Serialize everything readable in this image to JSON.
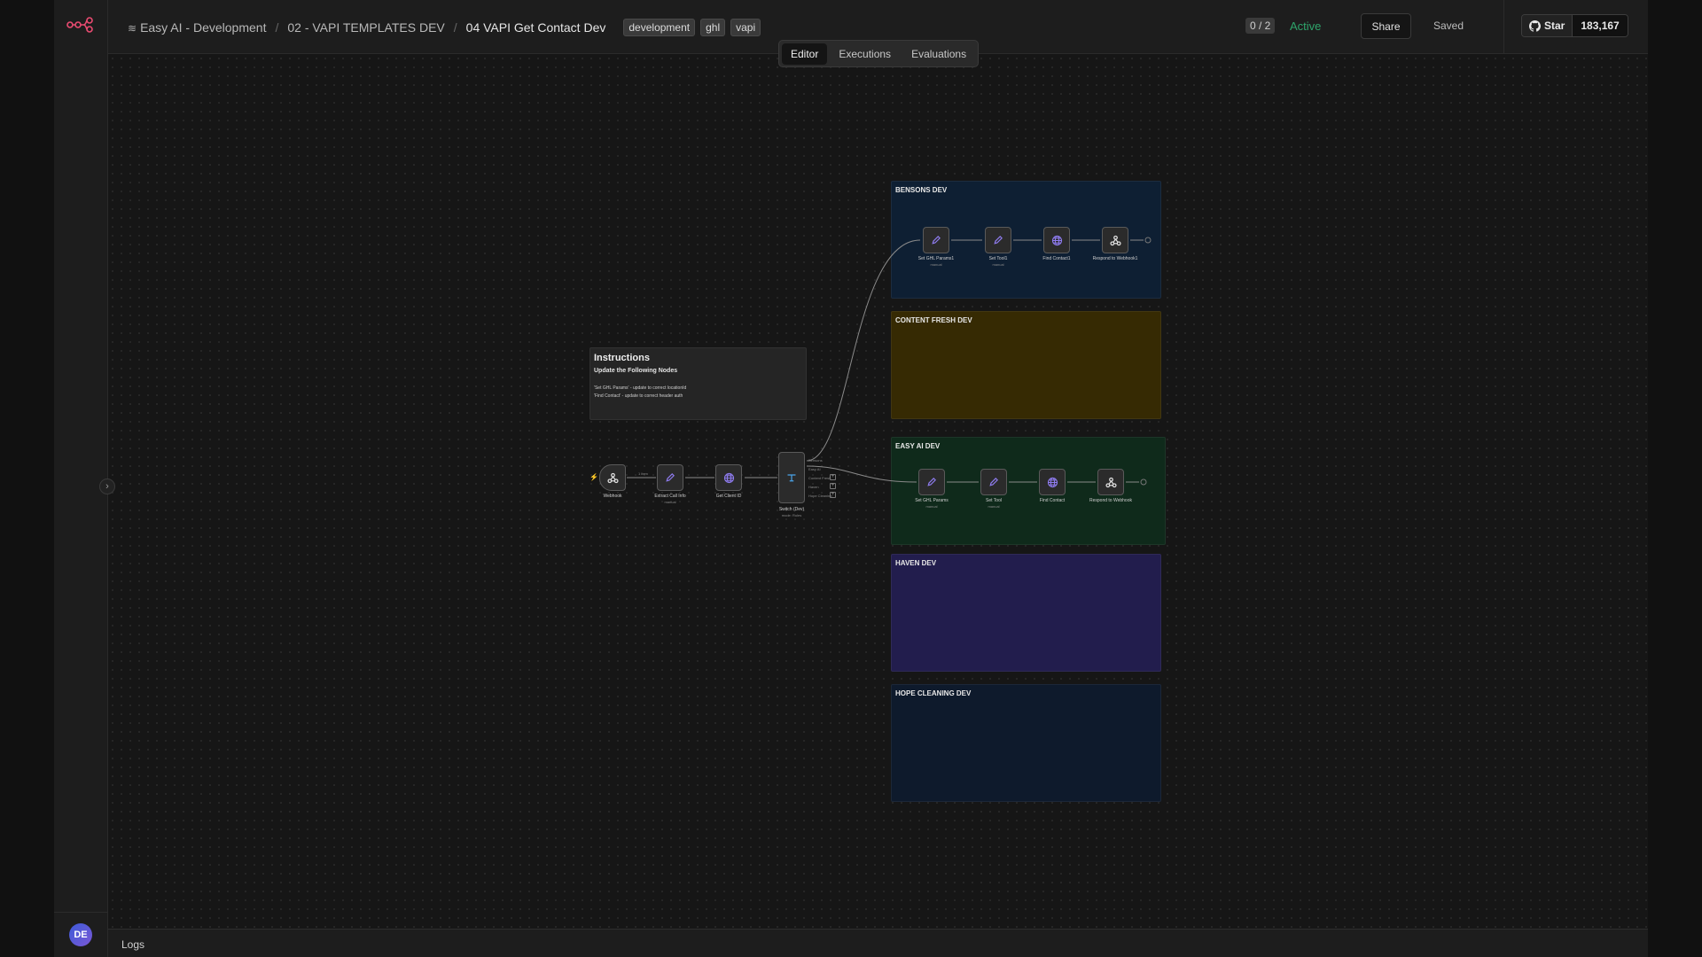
{
  "colors": {
    "background": "#161616",
    "sidebar": "#1d1d1d",
    "active": "#2ea56b",
    "brand": "#ea4b71",
    "node_icon": "#8f7cf0",
    "switch_icon": "#4aa3e8"
  },
  "sidebar": {
    "logo_icon": "n8n-logo-icon",
    "toggle_icon": "chevron-right-icon",
    "avatar_initials": "DE"
  },
  "header": {
    "breadcrumb": {
      "project_icon": "layers-icon",
      "project": "Easy AI - Development",
      "folder": "02 - VAPI TEMPLATES DEV",
      "workflow": "04 VAPI Get Contact Dev",
      "separator": "/"
    },
    "tags": [
      "development",
      "ghl",
      "vapi"
    ],
    "counter": "0 / 2",
    "status": "Active",
    "share_label": "Share",
    "saved_label": "Saved",
    "github": {
      "icon": "github-icon",
      "star_label": "Star",
      "count": "183,167"
    }
  },
  "tabs": [
    "Editor",
    "Executions",
    "Evaluations"
  ],
  "instructions": {
    "title": "Instructions",
    "subtitle": "Update the Following Nodes",
    "lines": [
      "'Set GHL Params' - update to correct locationId",
      "'Find Contact' - update to correct header auth"
    ]
  },
  "groups": [
    {
      "title": "BENSONS DEV"
    },
    {
      "title": "CONTENT FRESH DEV"
    },
    {
      "title": "EASY AI DEV"
    },
    {
      "title": "HAVEN DEV"
    },
    {
      "title": "HOPE CLEANING DEV"
    }
  ],
  "main_flow": {
    "nodes": [
      {
        "label": "Webhook",
        "icon": "webhook-icon"
      },
      {
        "label": "Extract Call Info",
        "sub": "manual",
        "icon": "pencil-icon"
      },
      {
        "label": "Get Client ID",
        "icon": "globe-icon"
      },
      {
        "label": "Switch (Dev)",
        "sub": "mode: Rules",
        "icon": "switch-icon"
      }
    ],
    "connection_label": "1 item"
  },
  "bensons_flow": {
    "nodes": [
      {
        "label": "Set GHL Params1",
        "sub": "manual",
        "icon": "pencil-icon"
      },
      {
        "label": "Set Tool1",
        "sub": "manual",
        "icon": "pencil-icon"
      },
      {
        "label": "Find Contact1",
        "icon": "globe-icon"
      },
      {
        "label": "Respond to Webhook1",
        "icon": "webhook-icon"
      }
    ]
  },
  "easy_flow": {
    "nodes": [
      {
        "label": "Set GHL Params",
        "sub": "manual",
        "icon": "pencil-icon"
      },
      {
        "label": "Set Tool",
        "sub": "manual",
        "icon": "pencil-icon"
      },
      {
        "label": "Find Contact",
        "icon": "globe-icon"
      },
      {
        "label": "Respond to Webhook",
        "icon": "webhook-icon"
      }
    ]
  },
  "switch_outputs": [
    "Bensons",
    "Easy AI",
    "Content Fresh",
    "Haven",
    "Hope Cleaning"
  ],
  "logs": {
    "label": "Logs"
  }
}
